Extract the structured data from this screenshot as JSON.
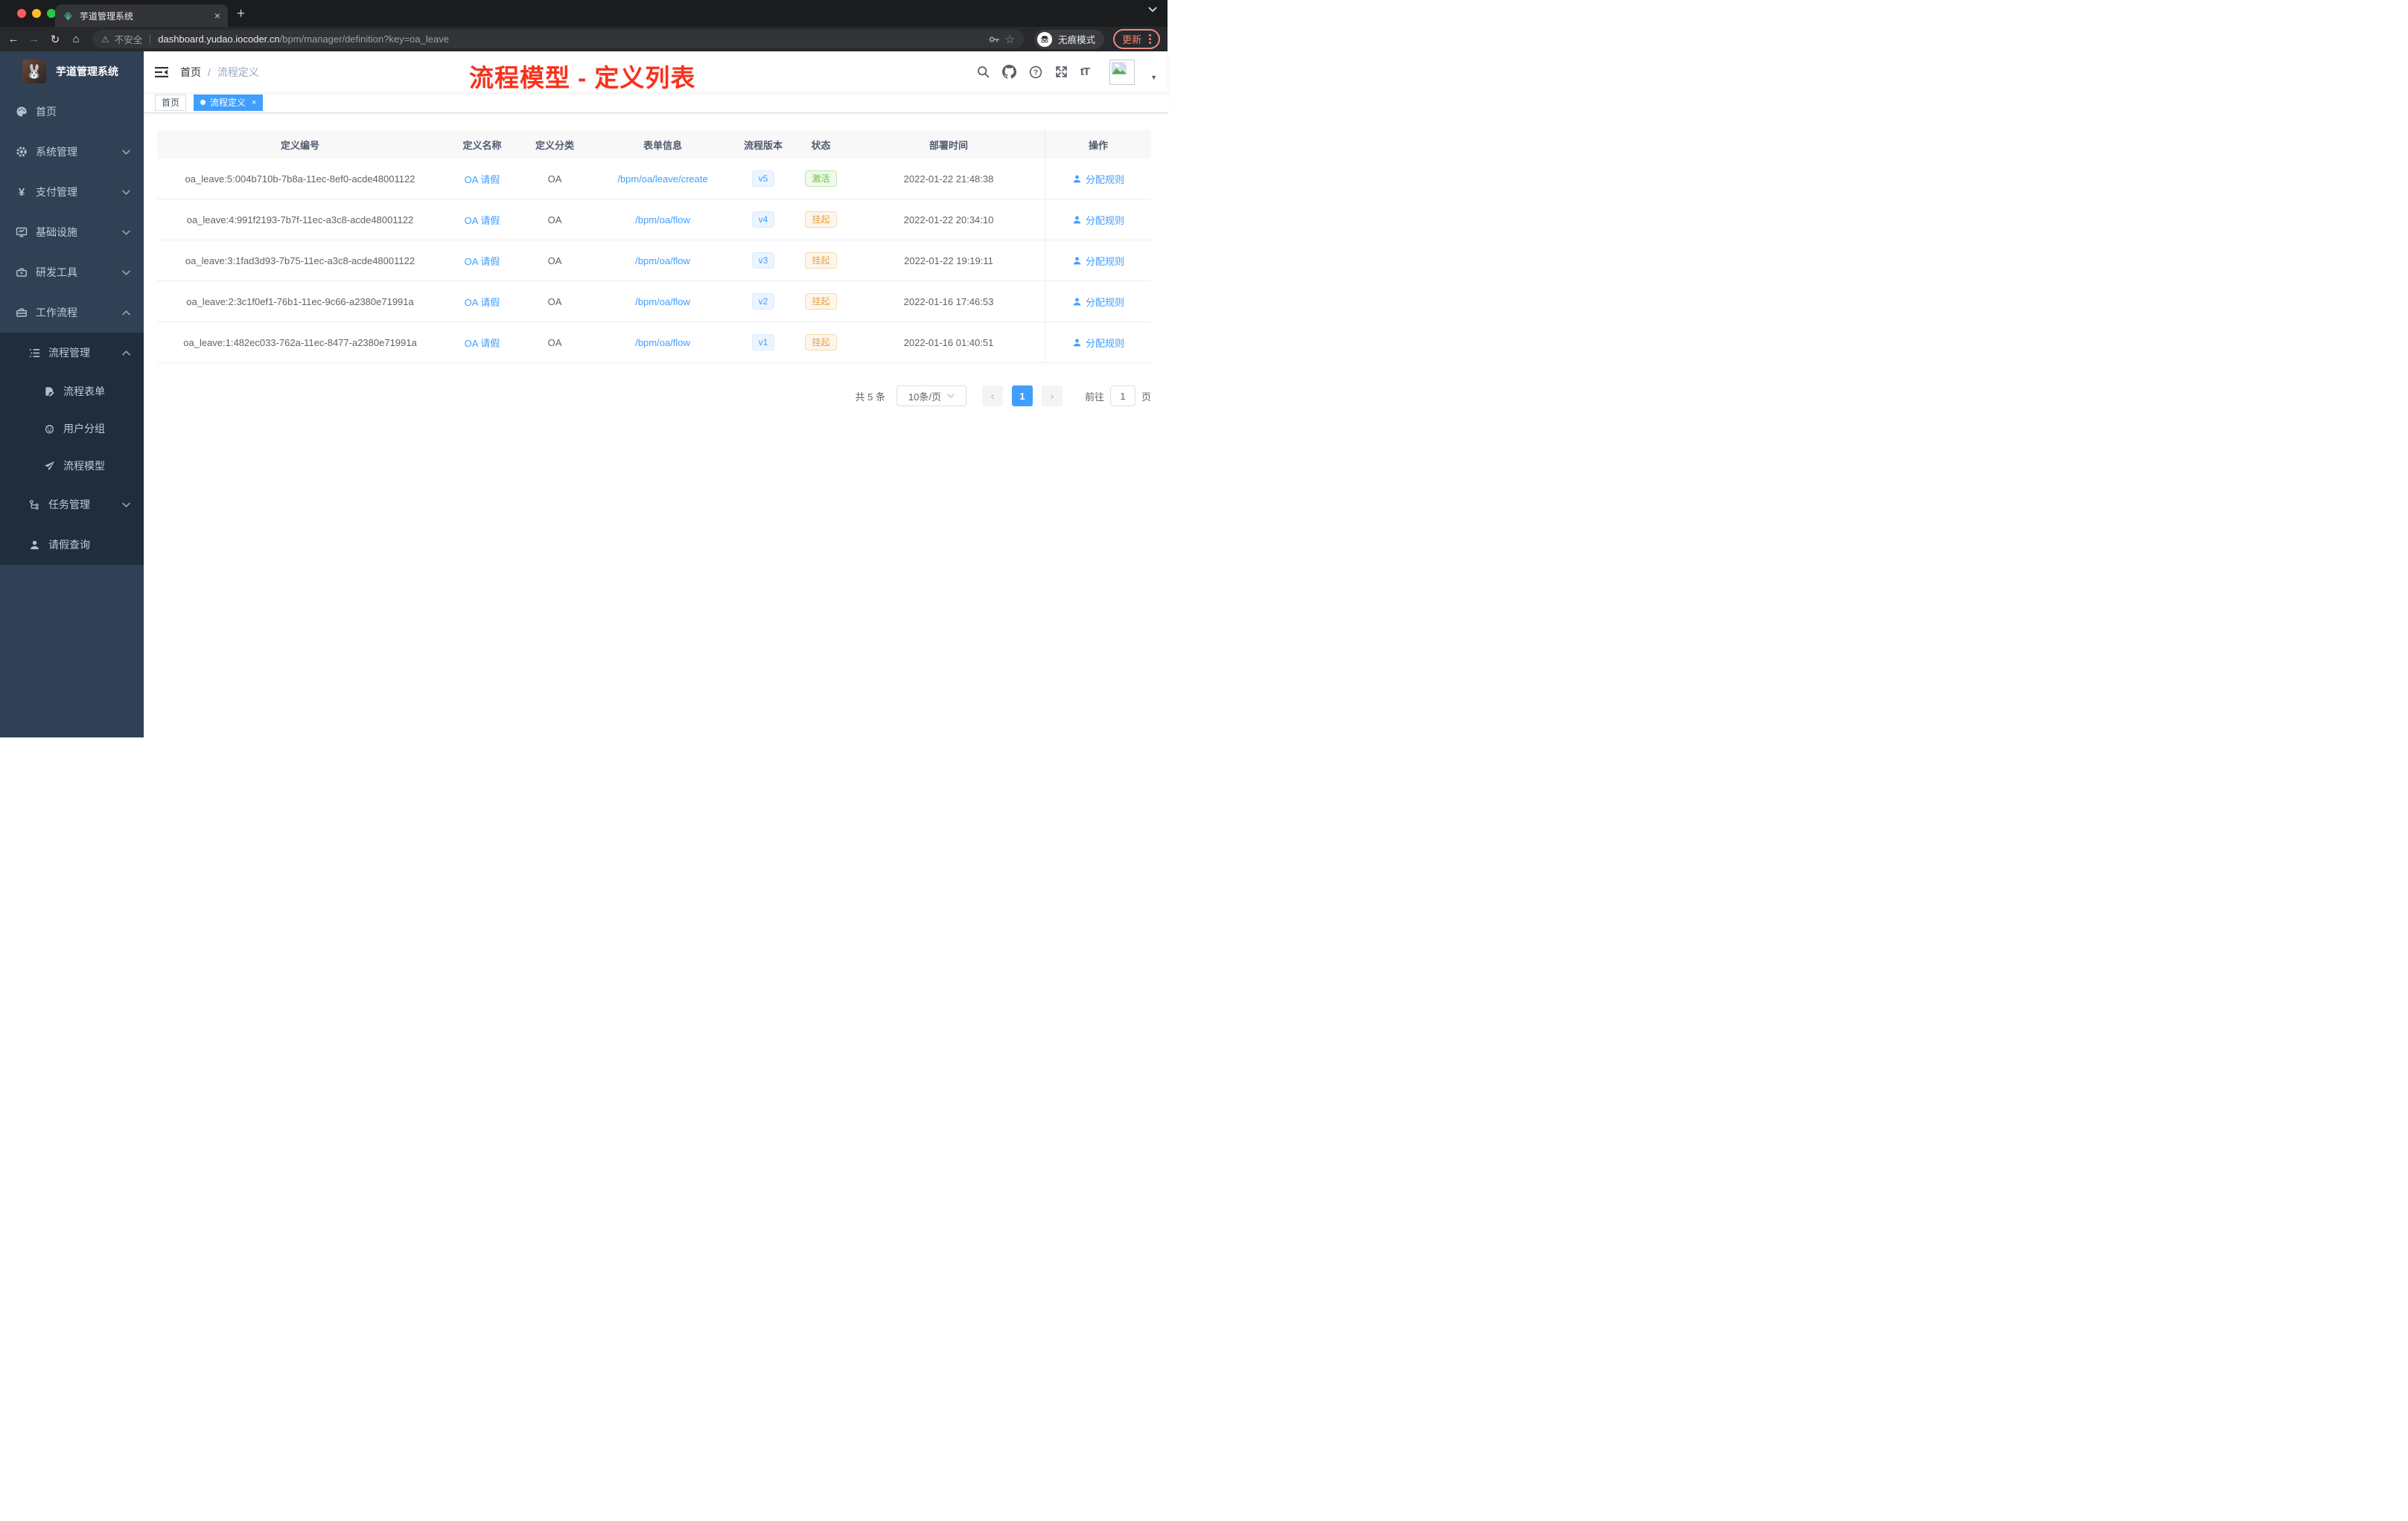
{
  "colors": {
    "accent": "#409eff",
    "sidebar_bg": "#304156",
    "submenu_bg": "#1f2d3d",
    "sidebar_text": "#bfcbd9",
    "success": "#67c23a",
    "warning": "#e6a23c",
    "title_red": "#f7321c"
  },
  "browser": {
    "tab_title": "芋道管理系统",
    "tab_close": "×",
    "new_tab": "+",
    "back": "←",
    "forward": "→",
    "reload": "↻",
    "home": "⌂",
    "security_warning": "⚠",
    "security_label": "不安全",
    "url_domain": "dashboard.yudao.iocoder.cn",
    "url_path": "/bpm/manager/definition?key=oa_leave",
    "star": "☆",
    "incognito_label": "无痕模式",
    "update_label": "更新"
  },
  "sidebar": {
    "title": "芋道管理系统",
    "avatar_emoji": "🐰",
    "items": [
      {
        "label": "首页",
        "icon": "dashboard-icon"
      },
      {
        "label": "系统管理",
        "icon": "gear-icon"
      },
      {
        "label": "支付管理",
        "icon": "yen-icon",
        "icon_glyph": "¥"
      },
      {
        "label": "基础设施",
        "icon": "monitor-icon"
      },
      {
        "label": "研发工具",
        "icon": "toolbox-icon"
      },
      {
        "label": "工作流程",
        "icon": "briefcase-icon"
      }
    ],
    "workflow_submenu": [
      {
        "label": "流程管理",
        "icon": "list-tree-icon"
      },
      {
        "label": "流程表单",
        "icon": "form-edit-icon"
      },
      {
        "label": "用户分组",
        "icon": "robot-icon"
      },
      {
        "label": "流程模型",
        "icon": "paper-plane-icon"
      },
      {
        "label": "任务管理",
        "icon": "task-tree-icon"
      },
      {
        "label": "请假查询",
        "icon": "user-icon"
      }
    ]
  },
  "header": {
    "breadcrumb": [
      "首页",
      "流程定义"
    ],
    "breadcrumb_separator": "/",
    "overlay_title": "流程模型 - 定义列表",
    "font_size_label": "tT"
  },
  "tags": [
    {
      "label": "首页",
      "active": false
    },
    {
      "label": "流程定义",
      "active": true,
      "close": "×"
    }
  ],
  "table": {
    "columns": [
      "定义编号",
      "定义名称",
      "定义分类",
      "表单信息",
      "流程版本",
      "状态",
      "部署时间",
      "操作"
    ],
    "action_label": "分配规则",
    "rows": [
      {
        "id": "oa_leave:5:004b710b-7b8a-11ec-8ef0-acde48001122",
        "name": "OA 请假",
        "category": "OA",
        "form": "/bpm/oa/leave/create",
        "version": "v5",
        "status": "激活",
        "status_type": "success",
        "deploy_time": "2022-01-22 21:48:38"
      },
      {
        "id": "oa_leave:4:991f2193-7b7f-11ec-a3c8-acde48001122",
        "name": "OA 请假",
        "category": "OA",
        "form": "/bpm/oa/flow",
        "version": "v4",
        "status": "挂起",
        "status_type": "warning",
        "deploy_time": "2022-01-22 20:34:10"
      },
      {
        "id": "oa_leave:3:1fad3d93-7b75-11ec-a3c8-acde48001122",
        "name": "OA 请假",
        "category": "OA",
        "form": "/bpm/oa/flow",
        "version": "v3",
        "status": "挂起",
        "status_type": "warning",
        "deploy_time": "2022-01-22 19:19:11"
      },
      {
        "id": "oa_leave:2:3c1f0ef1-76b1-11ec-9c66-a2380e71991a",
        "name": "OA 请假",
        "category": "OA",
        "form": "/bpm/oa/flow",
        "version": "v2",
        "status": "挂起",
        "status_type": "warning",
        "deploy_time": "2022-01-16 17:46:53"
      },
      {
        "id": "oa_leave:1:482ec033-762a-11ec-8477-a2380e71991a",
        "name": "OA 请假",
        "category": "OA",
        "form": "/bpm/oa/flow",
        "version": "v1",
        "status": "挂起",
        "status_type": "warning",
        "deploy_time": "2022-01-16 01:40:51"
      }
    ]
  },
  "pagination": {
    "total": "共 5 条",
    "page_size": "10条/页",
    "prev": "‹",
    "page": "1",
    "next": "›",
    "goto_label": "前往",
    "goto_value": "1",
    "page_unit": "页"
  }
}
